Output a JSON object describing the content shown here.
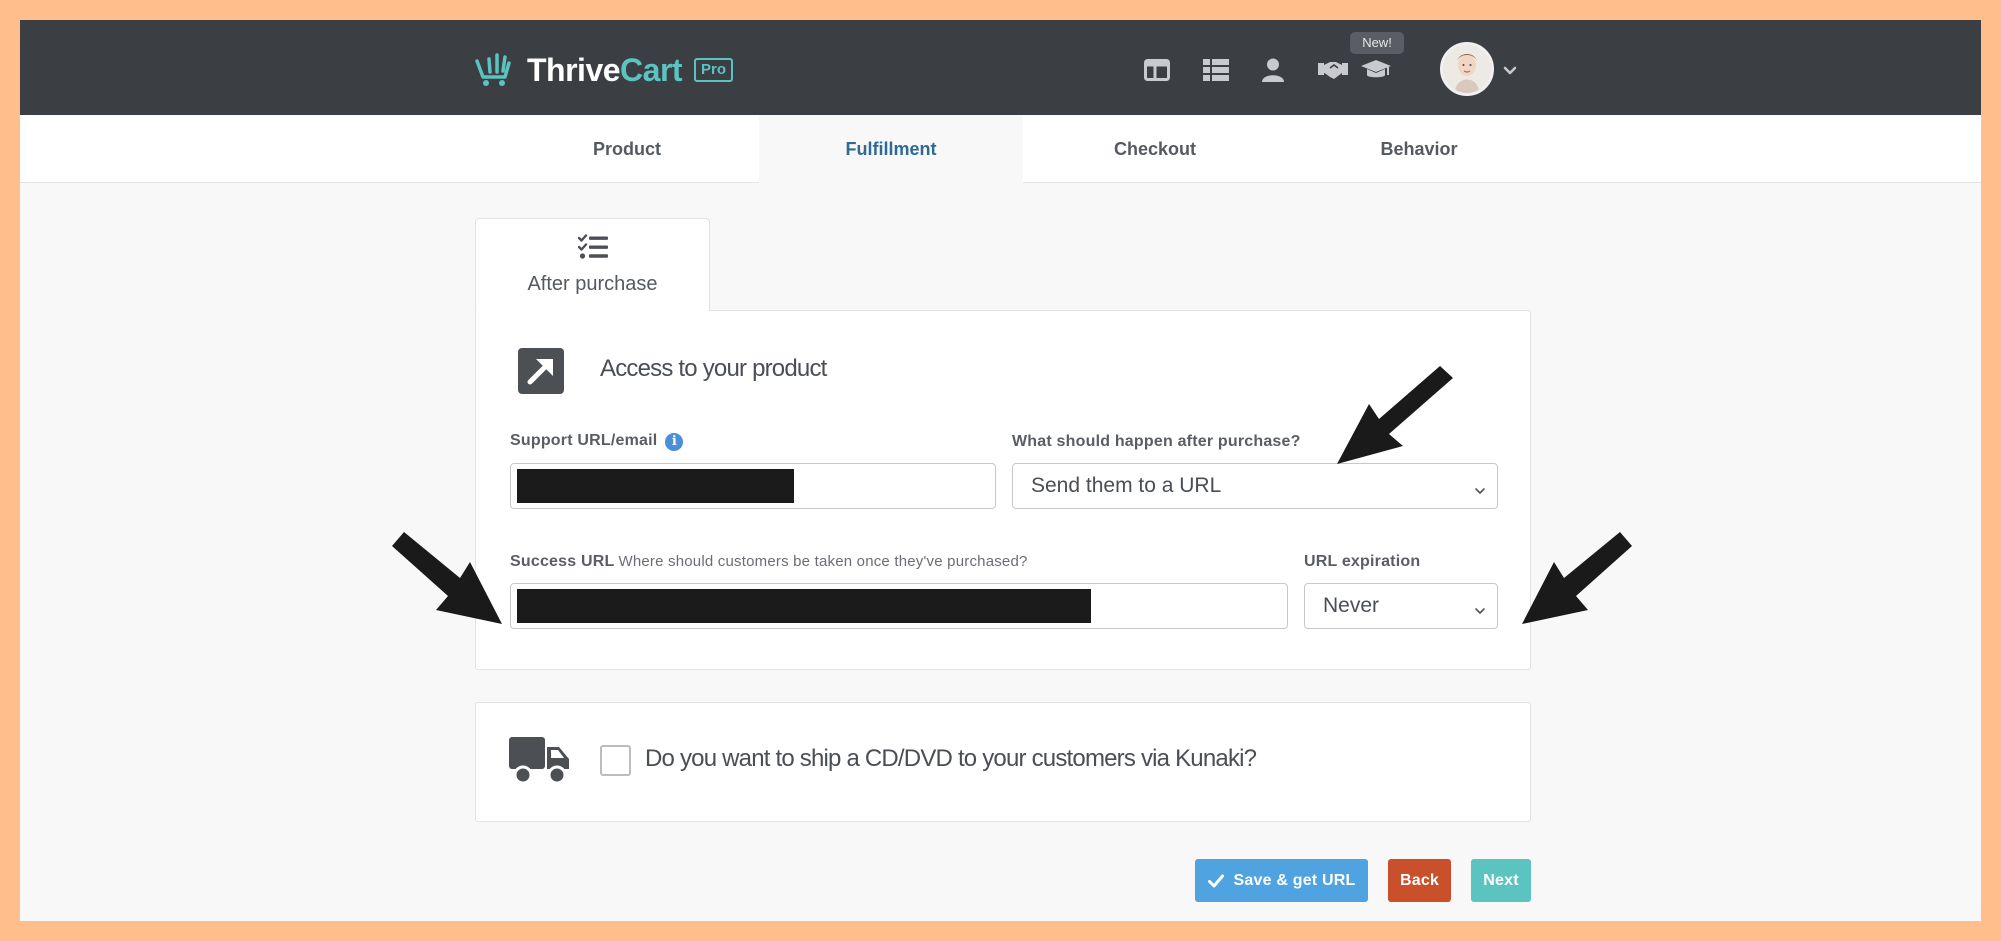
{
  "brand": {
    "name_part1": "Thrive",
    "name_part2": "Cart",
    "badge": "Pro"
  },
  "topbar": {
    "new_badge": "New!",
    "icons": [
      "layout-icon",
      "list-icon",
      "user-icon",
      "handshake-icon",
      "graduation-cap-icon"
    ]
  },
  "tabs": [
    {
      "label": "Product",
      "active": false
    },
    {
      "label": "Fulfillment",
      "active": true
    },
    {
      "label": "Checkout",
      "active": false
    },
    {
      "label": "Behavior",
      "active": false
    }
  ],
  "subtab": {
    "label": "After purchase"
  },
  "access_section": {
    "title": "Access to your product",
    "support_label": "Support URL/email",
    "after_purchase_label": "What should happen after purchase?",
    "after_purchase_value": "Send them to a URL",
    "success_url_label": "Success URL",
    "success_url_hint": "Where should customers be taken once they've purchased?",
    "url_expiration_label": "URL expiration",
    "url_expiration_value": "Never"
  },
  "shipping_section": {
    "question": "Do you want to ship a CD/DVD to your customers via Kunaki?",
    "checked": false
  },
  "actions": {
    "save": "Save & get URL",
    "back": "Back",
    "next": "Next"
  },
  "colors": {
    "topbar": "#3B3E43",
    "accent_teal": "#5CC4C0",
    "active_tab": "#2E6A96",
    "save_button": "#4FA3E0",
    "back_button": "#C9502A",
    "outer_frame": "#FFBE8C"
  }
}
